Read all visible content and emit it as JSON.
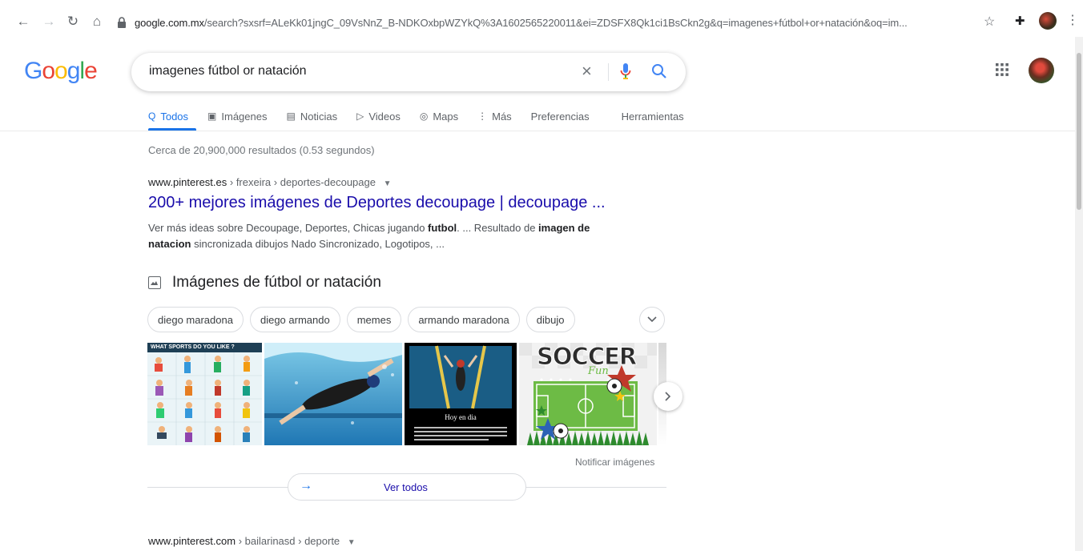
{
  "browser": {
    "url_domain": "google.com.mx",
    "url_rest": "/search?sxsrf=ALeKk01jngC_09VsNnZ_B-NDKOxbpWZYkQ%3A1602565220011&ei=ZDSFX8Qk1ci1BsCkn2g&q=imagenes+fútbol+or+natación&oq=im...",
    "icons": [
      "back-icon",
      "forward-icon",
      "reload-icon",
      "home-icon",
      "lock-icon",
      "star-icon",
      "extensions-icon",
      "menu-icon"
    ]
  },
  "header": {
    "logo": [
      "G",
      "o",
      "o",
      "g",
      "l",
      "e"
    ],
    "logo_colors": [
      "#4285f4",
      "#ea4335",
      "#fbbc05",
      "#4285f4",
      "#34a853",
      "#ea4335"
    ],
    "query": "imagenes fútbol or natación"
  },
  "tabs": [
    {
      "label": "Todos",
      "icon": "search-icon",
      "active": true
    },
    {
      "label": "Imágenes",
      "icon": "image-icon"
    },
    {
      "label": "Noticias",
      "icon": "news-icon"
    },
    {
      "label": "Videos",
      "icon": "video-icon"
    },
    {
      "label": "Maps",
      "icon": "map-pin-icon"
    },
    {
      "label": "Más",
      "icon": "more-icon"
    },
    {
      "label": "Preferencias"
    },
    {
      "label": "Herramientas"
    }
  ],
  "results": {
    "stats": "Cerca de 20,900,000 resultados (0.53 segundos)",
    "first": {
      "domain": "www.pinterest.es",
      "path": " › frexeira › deportes-decoupage",
      "title": "200+ mejores imágenes de Deportes decoupage | decoupage ...",
      "snippet_1": "Ver más ideas sobre Decoupage, Deportes, Chicas jugando ",
      "snippet_b1": "futbol",
      "snippet_2": ". ... Resultado de ",
      "snippet_b2": "imagen de natacion",
      "snippet_3": " sincronizada dibujos Nado Sincronizado, Logotipos, ..."
    },
    "second": {
      "domain": "www.pinterest.com",
      "path": " › bailarinasd › deporte"
    }
  },
  "images": {
    "heading": "Imágenes de fútbol or natación",
    "chips": [
      "diego maradona",
      "diego armando",
      "memes",
      "armando maradona",
      "dibujo"
    ],
    "thumb1_caption": "WHAT SPORTS DO YOU LIKE ?",
    "thumb3_caption": "Hoy en dia",
    "thumb4_title": "SOCCER",
    "thumb4_sub": "Fun",
    "report": "Notificar imágenes",
    "view_all": "Ver todos"
  }
}
